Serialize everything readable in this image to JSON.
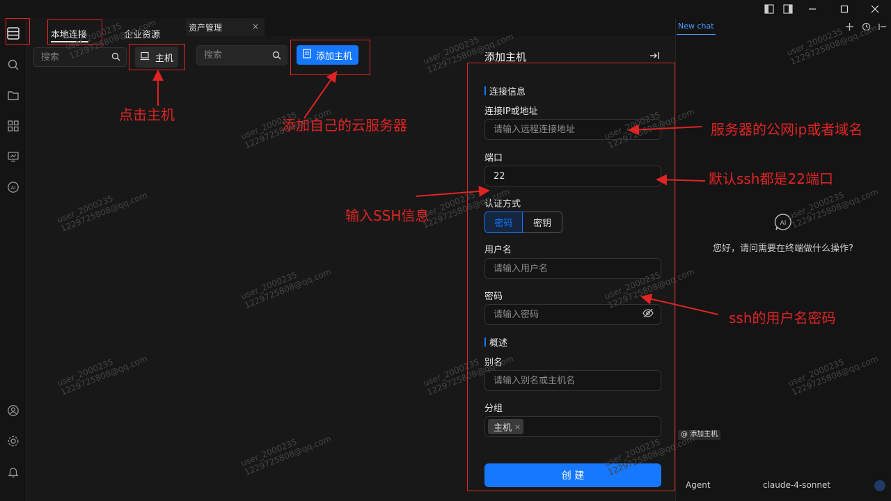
{
  "left": {
    "tabs": [
      {
        "label": "本地连接"
      },
      {
        "label": "企业资源"
      }
    ],
    "search_placeholder": "搜索",
    "host_button": "主机"
  },
  "main": {
    "tab_label": "资产管理",
    "tab_close": "×",
    "search_placeholder": "搜索",
    "add_host_button": "添加主机"
  },
  "form": {
    "title": "添加主机",
    "section_connection": "连接信息",
    "ip_label": "连接IP或地址",
    "ip_placeholder": "请输入远程连接地址",
    "port_label": "端口",
    "port_value": "22",
    "auth_label": "认证方式",
    "auth_options": [
      "密码",
      "密钥"
    ],
    "auth_selected": "密码",
    "username_label": "用户名",
    "username_placeholder": "请输入用户名",
    "password_label": "密码",
    "password_placeholder": "请输入密码",
    "section_overview": "概述",
    "alias_label": "别名",
    "alias_placeholder": "请输入别名或主机名",
    "group_label": "分组",
    "group_tag": "主机",
    "group_tag_close": "×",
    "create_button": "创 建"
  },
  "chat": {
    "tab_label": "New chat",
    "ai_badge": "AI",
    "greeting": "您好，请问需要在终端做什么操作?",
    "context_tag": "@ 添加主机",
    "agent_label": "Agent",
    "model_label": "claude-4-sonnet"
  },
  "annotations": {
    "click_host": "点击主机",
    "add_server": "添加自己的云服务器",
    "ssh_info": "输入SSH信息",
    "public_ip": "服务器的公网ip或者域名",
    "default_port": "默认ssh都是22端口",
    "ssh_user_pwd": "ssh的用户名密码"
  },
  "watermark": {
    "line1": "user_2000235",
    "line2": "1229725808@qq.com"
  },
  "colors": {
    "accent": "#1677ff",
    "annotation": "#e02424",
    "background": "#141414",
    "panel": "#181818"
  }
}
